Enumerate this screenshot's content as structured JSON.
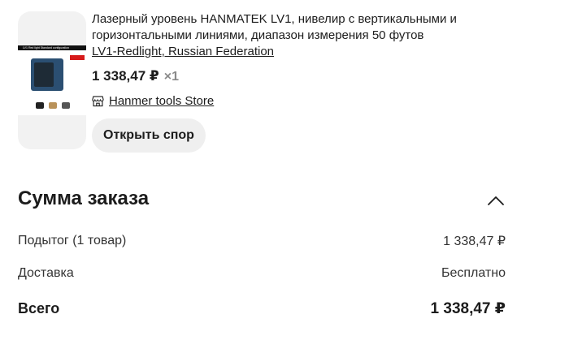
{
  "item": {
    "title": "Лазерный уровень HANMATEK LV1, нивелир с вертикальными и горизонтальными линиями, диапазон измерения 50 футов",
    "variant": "LV1-Redlight, Russian Federation",
    "price": "1 338,47 ₽",
    "quantity": "×1",
    "store_name": "Hanmer tools Store",
    "dispute_button": "Открыть спор",
    "thumbnail_caption": "LV1 Red light Standard configuration",
    "thumbnail_tag": "Red light",
    "thumbnail_icon": "product-image"
  },
  "summary": {
    "title": "Сумма заказа",
    "collapse_icon": "chevron-up-icon",
    "subtotal_label": "Подытог (1 товар)",
    "subtotal_value": "1 338,47 ₽",
    "delivery_label": "Доставка",
    "delivery_value": "Бесплатно",
    "total_label": "Всего",
    "total_value": "1 338,47 ₽"
  },
  "colors": {
    "text": "#1c1c1c",
    "muted": "#8a8a8a",
    "button_bg": "#efefef",
    "thumb_bg": "#f2f2f2"
  }
}
